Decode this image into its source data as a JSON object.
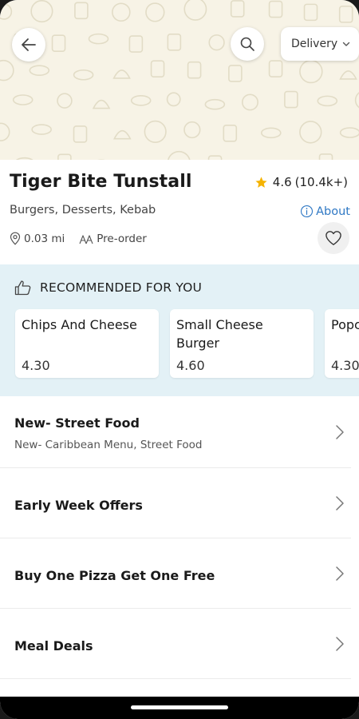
{
  "header": {
    "back_icon": "arrow-left-icon",
    "search_icon": "search-icon",
    "delivery_label": "Delivery",
    "delivery_chevron": "chevron-down-icon"
  },
  "restaurant": {
    "name": "Tiger Bite Tunstall",
    "rating": "4.6",
    "rating_count": "(10.4k+)",
    "cuisines": "Burgers, Desserts, Kebab",
    "about_label": "About",
    "distance": "0.03 mi",
    "order_mode": "Pre-order",
    "accent_color": "#f5b301",
    "link_color": "#2f78c4"
  },
  "recommended": {
    "title": "RECOMMENDED FOR YOU",
    "items": [
      {
        "name": "Chips And Cheese",
        "price": "4.30"
      },
      {
        "name": "Small Cheese Burger",
        "price": "4.60"
      },
      {
        "name": "Popc",
        "price": "4.30"
      }
    ]
  },
  "categories": [
    {
      "title": "New- Street Food",
      "subtitle": "New- Caribbean Menu, Street Food"
    },
    {
      "title": "Early Week Offers",
      "subtitle": ""
    },
    {
      "title": "Buy One Pizza Get One Free",
      "subtitle": ""
    },
    {
      "title": "Meal Deals",
      "subtitle": ""
    }
  ]
}
